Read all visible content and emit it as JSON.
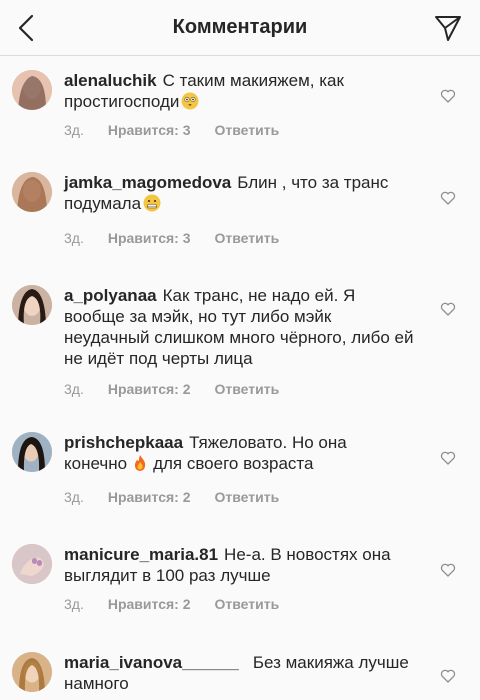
{
  "header": {
    "title": "Комментарии"
  },
  "comments": [
    {
      "username": "alenaluchik",
      "text": "С таким макияжем, как простигосподи",
      "emoji": "flushed-face",
      "time": "3д.",
      "likes": "Нравится: 3",
      "reply": "Ответить"
    },
    {
      "username": "jamka_magomedova",
      "text": "Блин , что за транс подумала",
      "emoji": "grimacing-face",
      "time": "3д.",
      "likes": "Нравится: 3",
      "reply": "Ответить"
    },
    {
      "username": "a_polyanaa",
      "text": "Как транс, не надо ей. Я вообще за мэйк, но тут либо мэйк неудачный слишком много чёрного, либо ей не идёт под черты лица",
      "time": "3д.",
      "likes": "Нравится: 2",
      "reply": "Ответить"
    },
    {
      "username": "prishchepkaaa",
      "text_before": "Тяжеловато. Но она конечно",
      "emoji": "fire",
      "text_after": "для своего возраста",
      "time": "3д.",
      "likes": "Нравится: 2",
      "reply": "Ответить"
    },
    {
      "username": "manicure_maria.81",
      "text": "Не-а. В новостях она выглядит в 100 раз лучше",
      "time": "3д.",
      "likes": "Нравится: 2",
      "reply": "Ответить"
    },
    {
      "username": "maria_ivanova______",
      "text": "Без макияжа лучше намного"
    }
  ],
  "colors": {
    "text": "#262626",
    "meta": "#999999",
    "divider": "#dbdbdb",
    "background": "#fafafa"
  }
}
